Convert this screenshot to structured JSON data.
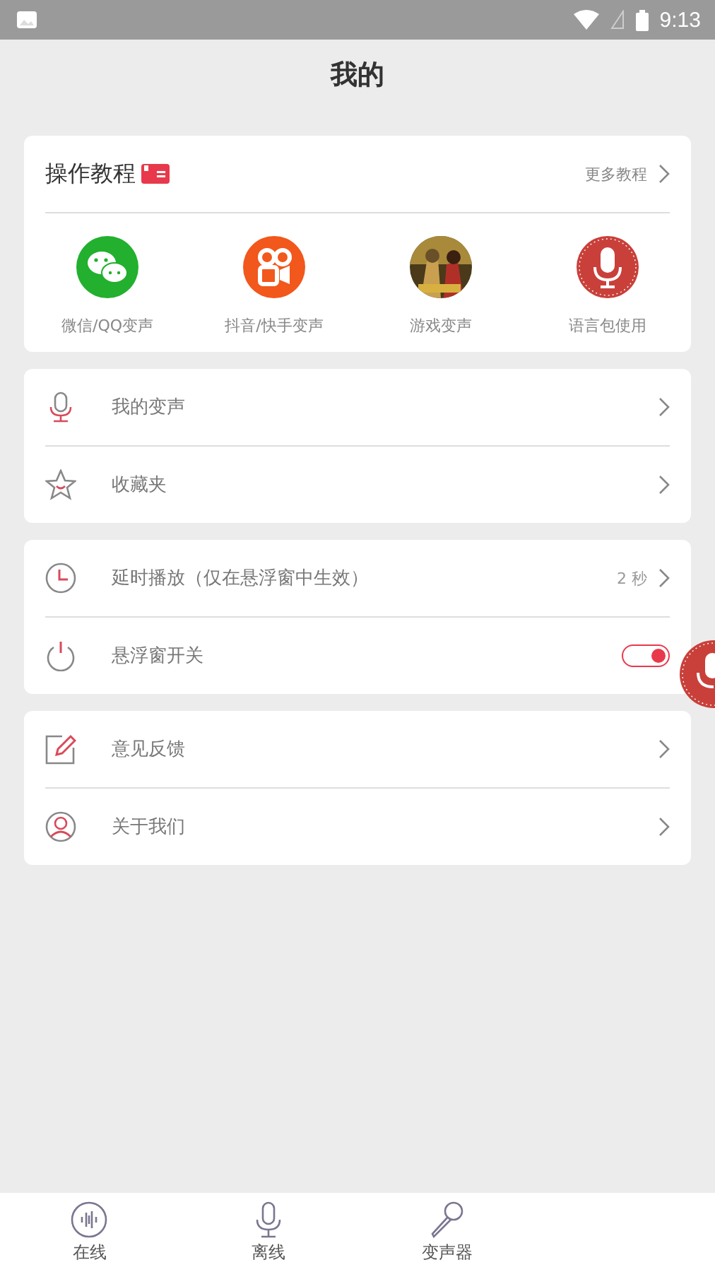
{
  "status_bar": {
    "time": "9:13"
  },
  "title": "我的",
  "tutorials": {
    "title": "操作教程",
    "more": "更多教程",
    "items": [
      {
        "label": "微信/QQ变声"
      },
      {
        "label": "抖音/快手变声"
      },
      {
        "label": "游戏变声"
      },
      {
        "label": "语言包使用"
      }
    ]
  },
  "groups": [
    {
      "items": [
        {
          "kind": "link",
          "label": "我的变声"
        },
        {
          "kind": "link",
          "label": "收藏夹"
        }
      ]
    },
    {
      "items": [
        {
          "kind": "link",
          "label": "延时播放（仅在悬浮窗中生效）",
          "value": "2 秒"
        },
        {
          "kind": "toggle",
          "label": "悬浮窗开关",
          "on": true
        }
      ]
    },
    {
      "items": [
        {
          "kind": "link",
          "label": "意见反馈"
        },
        {
          "kind": "link",
          "label": "关于我们"
        }
      ]
    }
  ],
  "tabs": [
    {
      "label": "在线"
    },
    {
      "label": "离线"
    },
    {
      "label": "变声器"
    }
  ]
}
